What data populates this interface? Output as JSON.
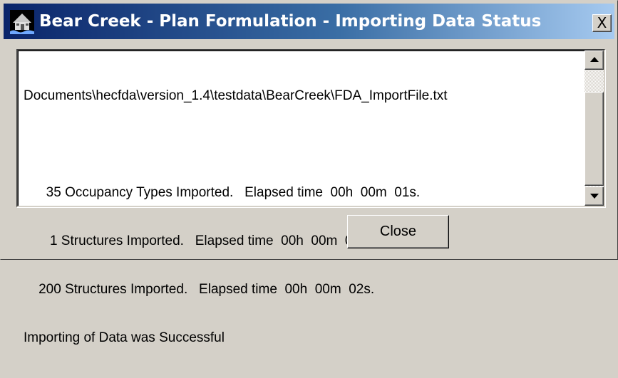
{
  "window": {
    "title": "Bear Creek - Plan Formulation - Importing Data Status",
    "close_glyph": "X",
    "app_icon": "hec-fda-house-icon",
    "titlebar_colors": [
      "#0a246a",
      "#a6caf0"
    ]
  },
  "status_log": {
    "lines": [
      "Documents\\hecfda\\version_1.4\\testdata\\BearCreek\\FDA_ImportFile.txt",
      "",
      "      35 Occupancy Types Imported.   Elapsed time  00h  00m  01s.",
      "       1 Structures Imported.   Elapsed time  00h  00m  01s.",
      "    200 Structures Imported.   Elapsed time  00h  00m  02s.",
      "Importing of Data was Successful"
    ]
  },
  "scrollbar": {
    "up_icon": "arrow-up-icon",
    "down_icon": "arrow-down-icon"
  },
  "buttons": {
    "close_label": "Close"
  }
}
